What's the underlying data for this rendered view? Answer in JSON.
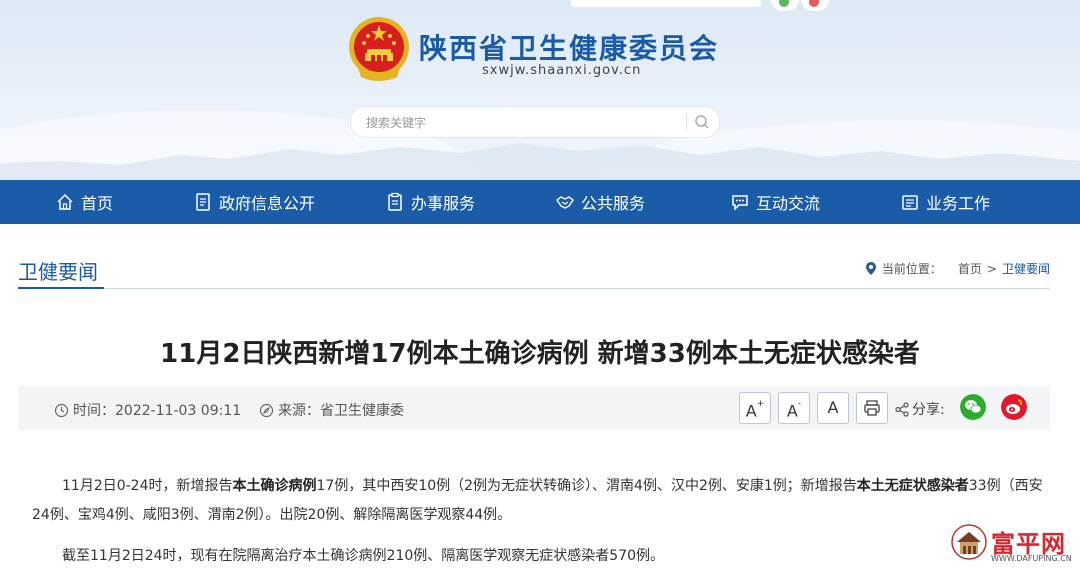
{
  "header": {
    "site_title": "陕西省卫生健康委员会",
    "site_domain": "sxwjw.shaanxi.gov.cn",
    "search_placeholder": "搜索关键字"
  },
  "nav": [
    {
      "label": "首页",
      "icon": "home-icon"
    },
    {
      "label": "政府信息公开",
      "icon": "document-icon"
    },
    {
      "label": "办事服务",
      "icon": "clipboard-icon"
    },
    {
      "label": "公共服务",
      "icon": "handshake-icon"
    },
    {
      "label": "互动交流",
      "icon": "chat-icon"
    },
    {
      "label": "业务工作",
      "icon": "briefcase-icon"
    }
  ],
  "section": {
    "title": "卫健要闻",
    "breadcrumb_label": "当前位置：",
    "breadcrumb_home": "首页",
    "breadcrumb_sep": ">",
    "breadcrumb_current": "卫健要闻"
  },
  "article": {
    "title": "11月2日陕西新增17例本土确诊病例 新增33例本土无症状感染者",
    "time": "时间：2022-11-03 09:11",
    "source": "来源：省卫生健康委",
    "font_large": "A",
    "font_large_sup": "+",
    "font_small": "A",
    "font_small_sup": "-",
    "font_reset": "A",
    "share_label": "分享:",
    "p1_a": "11月2日0-24时，新增报告",
    "p1_b": "本土确诊病例",
    "p1_c": "17例，其中西安10例（2例为无症状转确诊）、渭南4例、汉中2例、安康1例；新增报告",
    "p1_d": "本土无症状感染者",
    "p1_e": "33例（西安24例、宝鸡4例、咸阳3例、渭南2例）。出院20例、解除隔离医学观察44例。",
    "p2": "截至11月2日24时，现有在院隔离治疗本土确诊病例210例、隔离医学观察无症状感染者570例。"
  },
  "watermark": {
    "name": "富平网",
    "url": "WWW.DAFUPING.CN"
  },
  "colors": {
    "brand_blue": "#1b5ca8",
    "wechat_green": "#2aae2a",
    "weibo_red": "#e6162d"
  }
}
